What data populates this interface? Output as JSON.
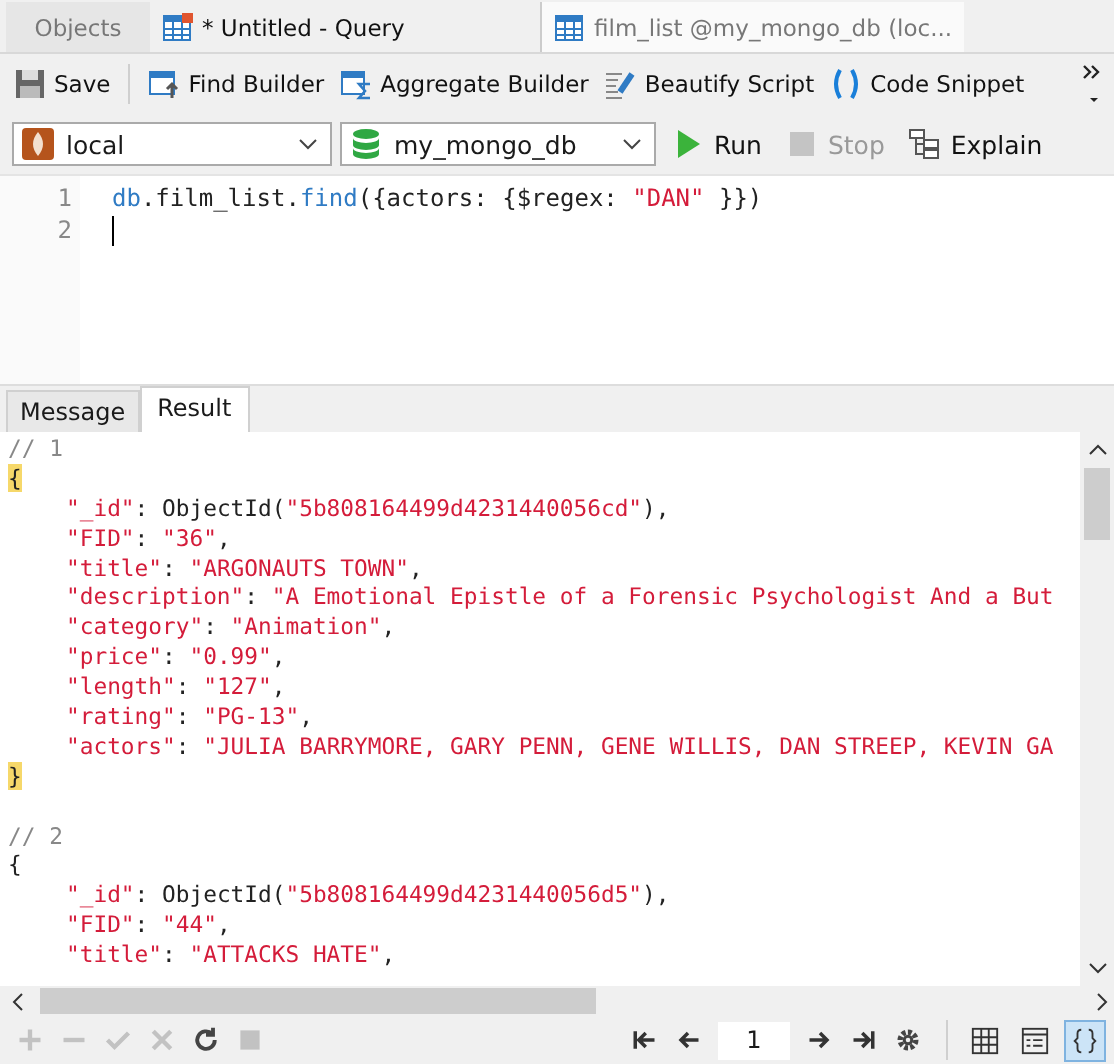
{
  "tabs": [
    {
      "label": "Objects",
      "kind": "plain",
      "selected": false
    },
    {
      "label": "* Untitled - Query",
      "kind": "query",
      "selected": true
    },
    {
      "label": "film_list @my_mongo_db (loc...",
      "kind": "table",
      "selected": false
    }
  ],
  "toolbar": [
    {
      "label": "Save",
      "kind": "save"
    },
    {
      "label": "Find Builder",
      "kind": "find"
    },
    {
      "label": "Aggregate Builder",
      "kind": "aggregate"
    },
    {
      "label": "Beautify Script",
      "kind": "beautify"
    },
    {
      "label": "Code Snippet",
      "kind": "snippet"
    }
  ],
  "connection": {
    "value": "local"
  },
  "database": {
    "value": "my_mongo_db"
  },
  "actions": [
    {
      "label": "Run",
      "kind": "run",
      "disabled": false
    },
    {
      "label": "Stop",
      "kind": "stop",
      "disabled": true
    },
    {
      "label": "Explain",
      "kind": "explain",
      "disabled": false
    }
  ],
  "editor": {
    "lines": [
      {
        "number": "1",
        "tokens": [
          {
            "t": "db",
            "kind": "keyword"
          },
          {
            "t": ".film_list.",
            "kind": "plain"
          },
          {
            "t": "find",
            "kind": "keyword"
          },
          {
            "t": "({actors: {$regex: ",
            "kind": "plain"
          },
          {
            "t": "\"DAN\"",
            "kind": "string"
          },
          {
            "t": " }})",
            "kind": "plain"
          }
        ]
      },
      {
        "number": "2"
      }
    ]
  },
  "result_tabs": [
    {
      "label": "Message",
      "selected": false
    },
    {
      "label": "Result",
      "selected": true
    }
  ],
  "documents": [
    {
      "comment": "// 1",
      "open": "{",
      "close": "}",
      "highlighted": true,
      "fields": [
        [
          {
            "t": "\"_id\"",
            "kind": "string"
          },
          {
            "t": ": ObjectId(",
            "kind": "plain"
          },
          {
            "t": "\"5b808164499d4231440056cd\"",
            "kind": "string"
          },
          {
            "t": "),",
            "kind": "plain"
          }
        ],
        [
          {
            "t": "\"FID\"",
            "kind": "string"
          },
          {
            "t": ": ",
            "kind": "plain"
          },
          {
            "t": "\"36\"",
            "kind": "string"
          },
          {
            "t": ",",
            "kind": "plain"
          }
        ],
        [
          {
            "t": "\"title\"",
            "kind": "string"
          },
          {
            "t": ": ",
            "kind": "plain"
          },
          {
            "t": "\"ARGONAUTS TOWN\"",
            "kind": "string"
          },
          {
            "t": ",",
            "kind": "plain"
          }
        ],
        [
          {
            "t": "\"description\"",
            "kind": "string"
          },
          {
            "t": ": ",
            "kind": "plain"
          },
          {
            "t": "\"A Emotional Epistle of a Forensic Psychologist And a But",
            "kind": "string"
          }
        ],
        [
          {
            "t": "\"category\"",
            "kind": "string"
          },
          {
            "t": ": ",
            "kind": "plain"
          },
          {
            "t": "\"Animation\"",
            "kind": "string"
          },
          {
            "t": ",",
            "kind": "plain"
          }
        ],
        [
          {
            "t": "\"price\"",
            "kind": "string"
          },
          {
            "t": ": ",
            "kind": "plain"
          },
          {
            "t": "\"0.99\"",
            "kind": "string"
          },
          {
            "t": ",",
            "kind": "plain"
          }
        ],
        [
          {
            "t": "\"length\"",
            "kind": "string"
          },
          {
            "t": ": ",
            "kind": "plain"
          },
          {
            "t": "\"127\"",
            "kind": "string"
          },
          {
            "t": ",",
            "kind": "plain"
          }
        ],
        [
          {
            "t": "\"rating\"",
            "kind": "string"
          },
          {
            "t": ": ",
            "kind": "plain"
          },
          {
            "t": "\"PG-13\"",
            "kind": "string"
          },
          {
            "t": ",",
            "kind": "plain"
          }
        ],
        [
          {
            "t": "\"actors\"",
            "kind": "string"
          },
          {
            "t": ": ",
            "kind": "plain"
          },
          {
            "t": "\"JULIA BARRYMORE, GARY PENN, GENE WILLIS, DAN STREEP, KEVIN GA",
            "kind": "string"
          }
        ]
      ]
    },
    {
      "comment": "// 2",
      "open": "{",
      "highlighted": false,
      "fields": [
        [
          {
            "t": "\"_id\"",
            "kind": "string"
          },
          {
            "t": ": ObjectId(",
            "kind": "plain"
          },
          {
            "t": "\"5b808164499d4231440056d5\"",
            "kind": "string"
          },
          {
            "t": "),",
            "kind": "plain"
          }
        ],
        [
          {
            "t": "\"FID\"",
            "kind": "string"
          },
          {
            "t": ": ",
            "kind": "plain"
          },
          {
            "t": "\"44\"",
            "kind": "string"
          },
          {
            "t": ",",
            "kind": "plain"
          }
        ],
        [
          {
            "t": "\"title\"",
            "kind": "string"
          },
          {
            "t": ": ",
            "kind": "plain"
          },
          {
            "t": "\"ATTACKS HATE\"",
            "kind": "string"
          },
          {
            "t": ",",
            "kind": "plain"
          }
        ]
      ]
    }
  ],
  "record_tools": [
    {
      "kind": "add",
      "disabled": true
    },
    {
      "kind": "remove",
      "disabled": true
    },
    {
      "kind": "apply",
      "disabled": true
    },
    {
      "kind": "discard",
      "disabled": true
    },
    {
      "kind": "refresh",
      "disabled": false
    },
    {
      "kind": "stop",
      "disabled": true
    }
  ],
  "page": {
    "value": "1"
  },
  "views": [
    {
      "kind": "grid",
      "selected": false
    },
    {
      "kind": "form",
      "selected": false
    },
    {
      "kind": "text",
      "selected": true
    }
  ]
}
